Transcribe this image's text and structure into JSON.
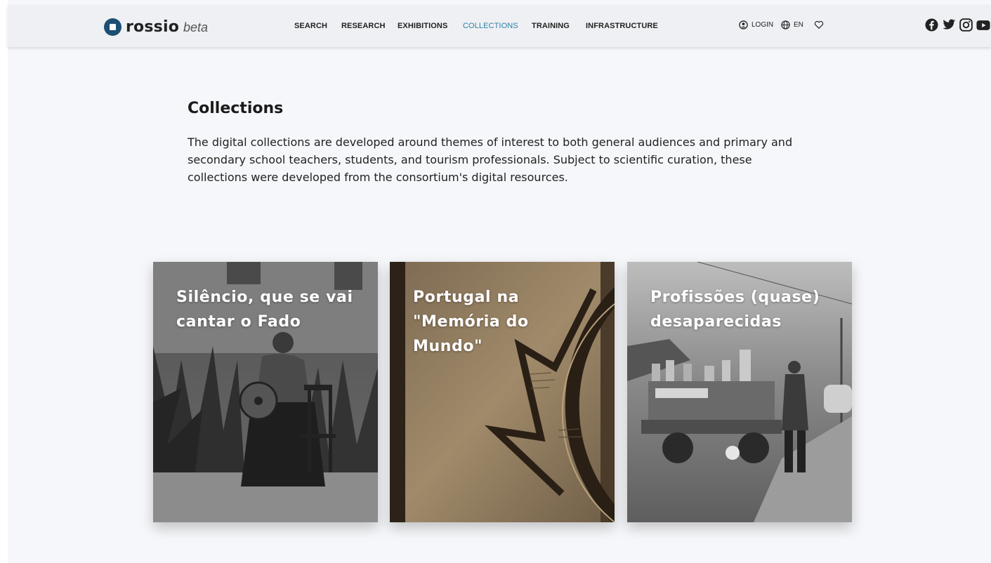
{
  "brand": {
    "name": "rossio",
    "tag": "beta"
  },
  "nav": {
    "items": [
      {
        "label": "SEARCH"
      },
      {
        "label": "RESEARCH"
      },
      {
        "label": "EXHIBITIONS"
      },
      {
        "label": "COLLECTIONS",
        "active": true
      },
      {
        "label": "TRAINING"
      },
      {
        "label": "INFRASTRUCTURE"
      }
    ],
    "login_label": "LOGIN",
    "language_label": "EN"
  },
  "social": [
    "facebook-icon",
    "twitter-icon",
    "instagram-icon",
    "youtube-icon"
  ],
  "page": {
    "title": "Collections",
    "intro": "The digital collections are developed around themes of interest to both general audiences and primary and secondary school teachers, students, and tourism professionals. Subject to scientific curation, these collections were developed from the consortium's digital resources."
  },
  "collections": [
    {
      "title": "Silêncio, que se vai cantar o Fado"
    },
    {
      "title": "Portugal na \"Memória do Mundo\""
    },
    {
      "title": "Profissões (quase) desaparecidas"
    }
  ],
  "colors": {
    "accent": "#2d7fa8",
    "brand": "#1d4e73",
    "background": "#f6f7fa"
  }
}
